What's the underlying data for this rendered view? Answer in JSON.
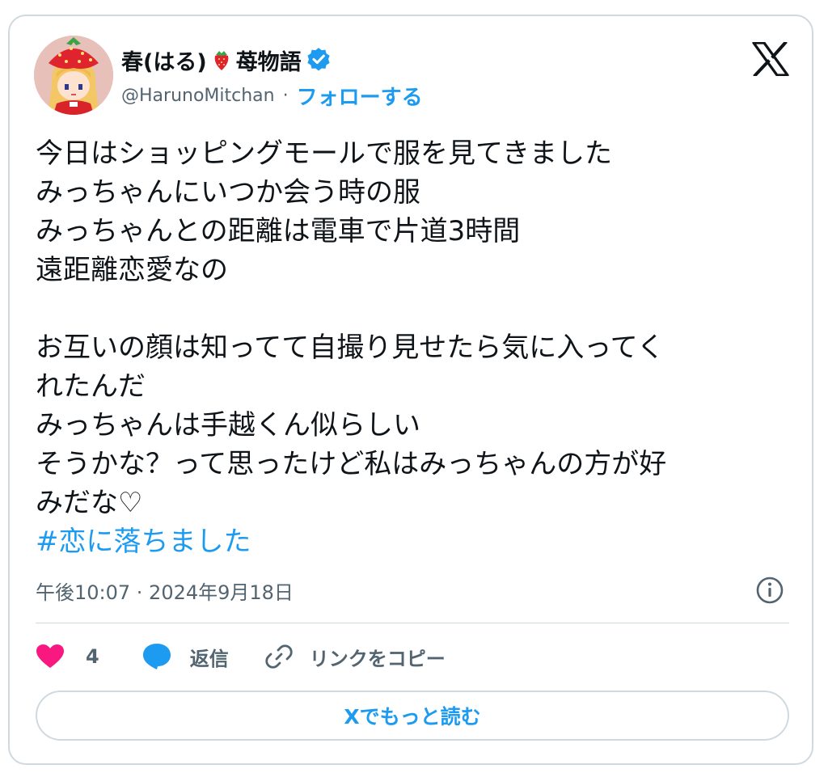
{
  "author": {
    "name": "春(はる)",
    "name_suffix": "苺物語",
    "handle": "@HarunoMitchan",
    "separator": "·",
    "follow_label": "フォローする"
  },
  "tweet": {
    "lines": [
      "今日はショッピングモールで服を見てきました",
      "みっちゃんにいつか会う時の服",
      "みっちゃんとの距離は電車で片道3時間",
      "遠距離恋愛なの",
      "",
      "お互いの顔は知ってて自撮り見せたら気に入ってく",
      "れたんだ",
      "みっちゃんは手越くん似らしい",
      "そうかな？って思ったけど私はみっちゃんの方が好",
      "みだな♡"
    ],
    "hashtag": "#恋に落ちました",
    "timestamp": "午後10:07 · 2024年9月18日"
  },
  "actions": {
    "like_count": "4",
    "reply_label": "返信",
    "copy_link_label": "リンクをコピー"
  },
  "read_more_label": "Xでもっと読む",
  "colors": {
    "accent": "#1d9bf0",
    "like": "#f91880",
    "text": "#0f1419",
    "muted": "#536471",
    "border": "#cfd9de"
  },
  "icons": [
    "strawberry-icon",
    "verified-badge-icon",
    "x-logo-icon",
    "info-icon",
    "heart-icon",
    "reply-bubble-icon",
    "link-icon"
  ]
}
